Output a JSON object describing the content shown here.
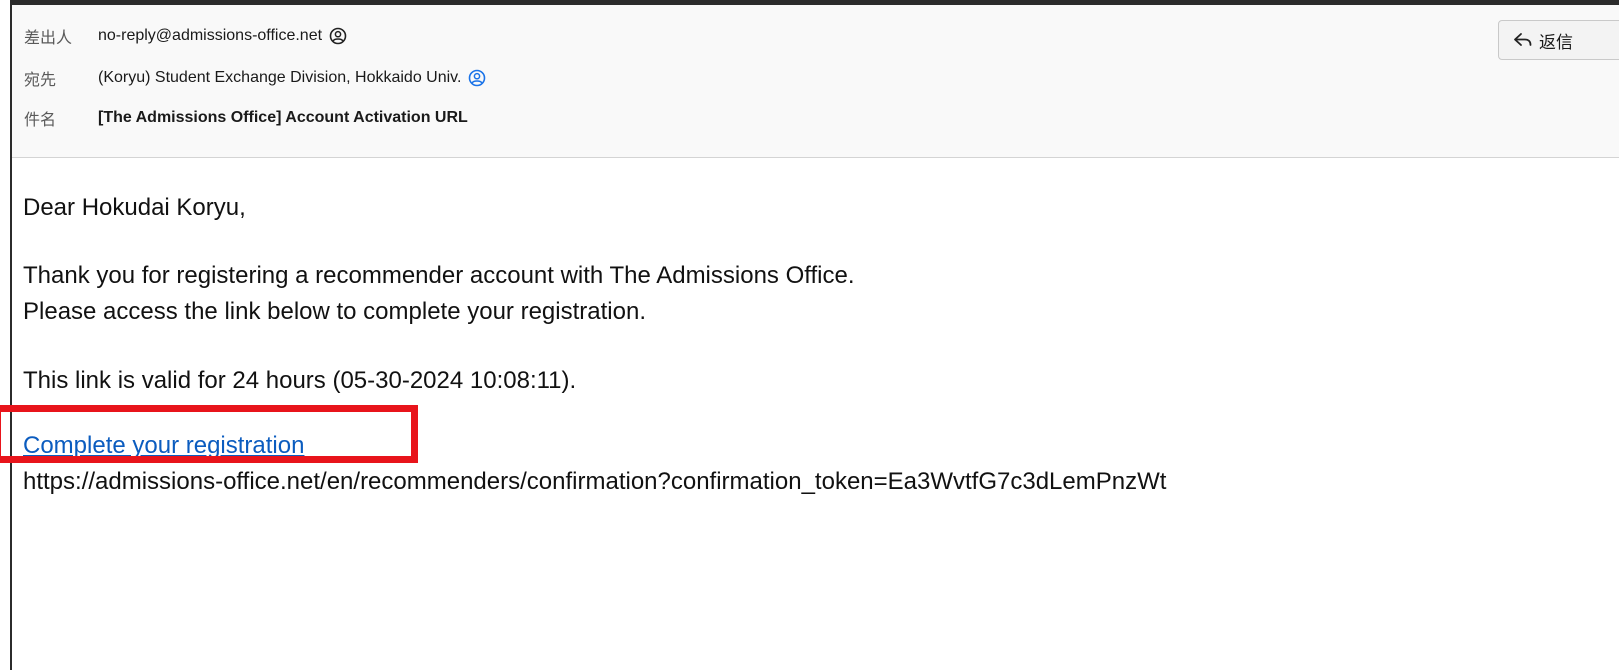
{
  "header": {
    "from_label": "差出人",
    "from_value": "no-reply@admissions-office.net",
    "to_label": "宛先",
    "to_value": "(Koryu) Student Exchange Division, Hokkaido Univ.",
    "subject_label": "件名",
    "subject_value": "[The Admissions Office] Account Activation URL",
    "reply_label": "返信"
  },
  "body": {
    "greeting": "Dear Hokudai Koryu,",
    "thanks_line1": "Thank you for registering a recommender account with The Admissions Office.",
    "thanks_line2": "Please access the link below to complete your registration.",
    "validity": "This link is valid for 24 hours (05-30-2024 10:08:11).",
    "link_text": "Complete your registration",
    "url": "https://admissions-office.net/en/recommenders/confirmation?confirmation_token=Ea3WvtfG7c3dLemPnzWt"
  },
  "colors": {
    "link": "#0b5cbf",
    "highlight": "#e8141b",
    "contact_icon_blue": "#1a73e8"
  },
  "icons": {
    "from_contact": "contact-person-icon",
    "to_contact": "contact-person-icon",
    "reply": "reply-arrow-icon"
  }
}
